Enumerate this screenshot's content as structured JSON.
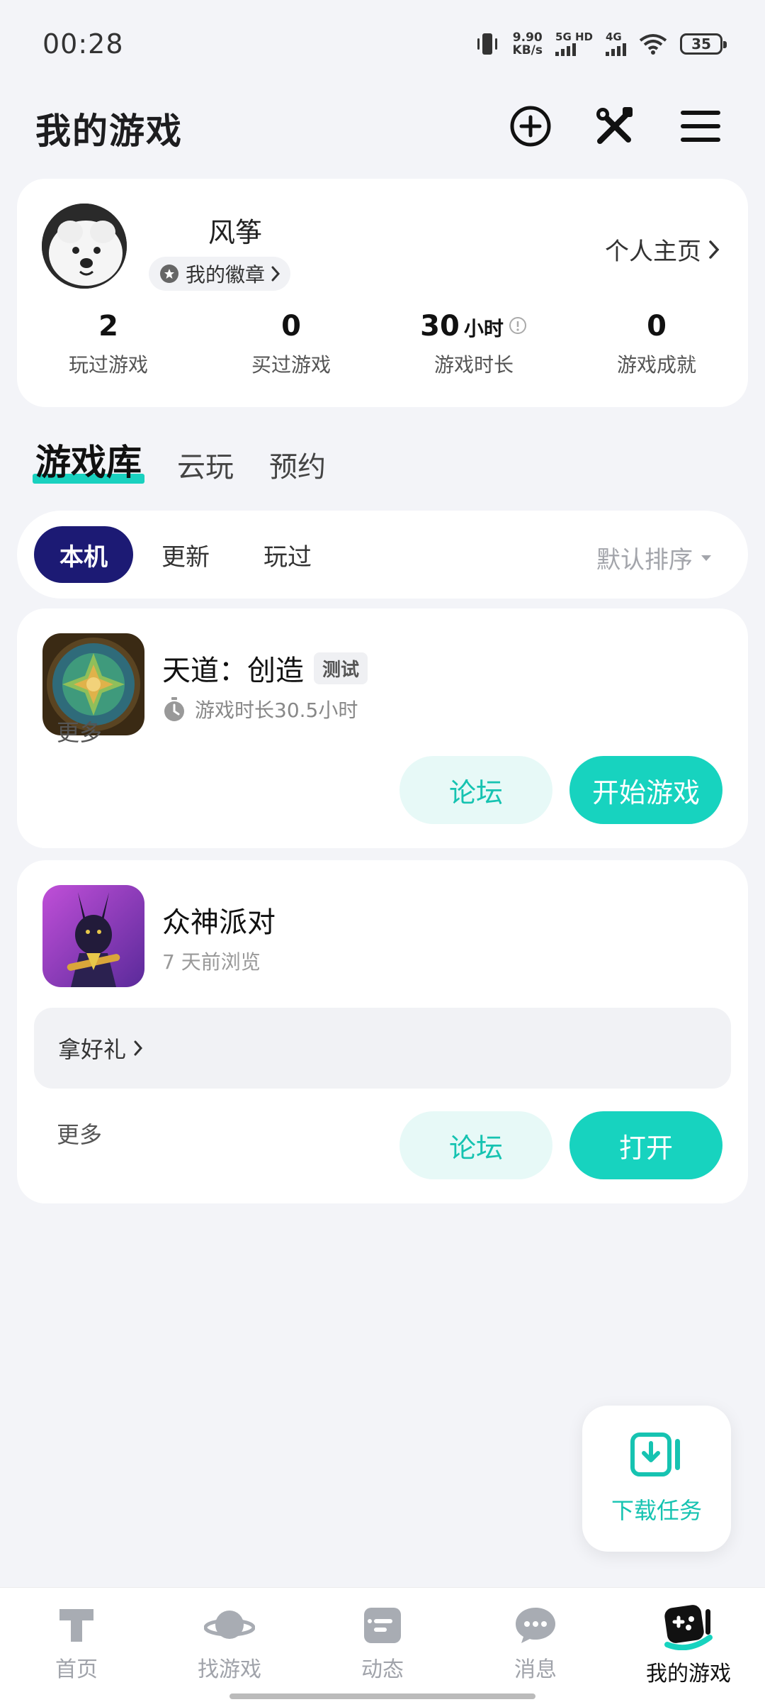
{
  "status_bar": {
    "time": "00:28",
    "net_speed_value": "9.90",
    "net_speed_unit": "KB/s",
    "sig1": "5G HD",
    "sig2": "4G",
    "battery": "35"
  },
  "header": {
    "title": "我的游戏",
    "icons": [
      "add-circle-icon",
      "tools-icon",
      "menu-icon"
    ]
  },
  "profile": {
    "nickname": "风筝",
    "badge_label": "我的徽章",
    "homepage_label": "个人主页",
    "stats": [
      {
        "value": "2",
        "unit": "",
        "label": "玩过游戏"
      },
      {
        "value": "0",
        "unit": "",
        "label": "买过游戏"
      },
      {
        "value": "30",
        "unit": "小时",
        "label": "游戏时长"
      },
      {
        "value": "0",
        "unit": "",
        "label": "游戏成就"
      }
    ]
  },
  "category_tabs": [
    "游戏库",
    "云玩",
    "预约"
  ],
  "filter": {
    "chips": [
      "本机",
      "更新",
      "玩过"
    ],
    "sort_label": "默认排序"
  },
  "games": [
    {
      "name": "天道：创造",
      "tag": "测试",
      "subtitle": "游戏时长30.5小时",
      "more_label": "更多",
      "forum_label": "论坛",
      "primary_label": "开始游戏"
    },
    {
      "name": "众神派对",
      "subtitle": "7 天前浏览",
      "gift_label": "拿好礼",
      "more_label": "更多",
      "forum_label": "论坛",
      "primary_label": "打开"
    }
  ],
  "download_fab": {
    "label": "下载任务"
  },
  "bottom_nav": [
    {
      "label": "首页",
      "icon": "home-icon"
    },
    {
      "label": "找游戏",
      "icon": "planet-icon"
    },
    {
      "label": "动态",
      "icon": "feed-icon"
    },
    {
      "label": "消息",
      "icon": "chat-icon"
    },
    {
      "label": "我的游戏",
      "icon": "gamepad-icon"
    }
  ],
  "colors": {
    "accent": "#17d3bf",
    "chip_active": "#1c1a74",
    "background": "#f3f4f8"
  }
}
